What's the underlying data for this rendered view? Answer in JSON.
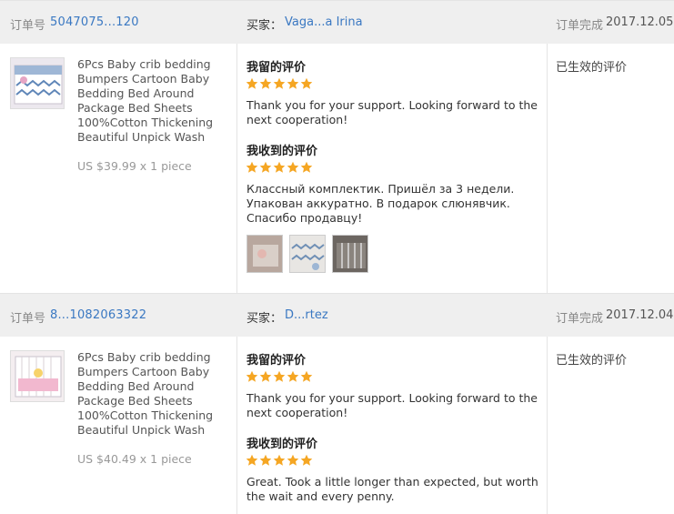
{
  "colors": {
    "header_bg": "#efefef",
    "link": "#3a78c2",
    "star": "#f5a623",
    "divider": "#e4e4e4"
  },
  "orders": [
    {
      "order_label": "订单号",
      "order_number": "5047075...120",
      "buyer_label": "买家：",
      "buyer_name": "Vaga...a Irina",
      "status_label": "订单完成",
      "date": "2017.12.05",
      "product": {
        "title": "6Pcs Baby crib bedding Bumpers Cartoon Baby Bedding Bed Around Package Bed Sheets 100%Cotton Thickening Beautiful Unpick Wash",
        "price": "US $39.99 x 1 piece"
      },
      "my_review": {
        "heading": "我留的评价",
        "rating": 5,
        "text": "Thank you for your support. Looking forward to the next cooperation!"
      },
      "received_review": {
        "heading": "我收到的评价",
        "rating": 5,
        "text": "Классный комплектик. Пришёл за 3 недели. Упакован аккуратно. В подарок слюнявчик. Спасибо продавцу!",
        "photos": [
          "photo-1",
          "photo-2",
          "photo-3"
        ]
      },
      "review_status": "已生效的评价"
    },
    {
      "order_label": "订单号",
      "order_number": "8...1082063322",
      "buyer_label": "买家：",
      "buyer_name": "D...rtez",
      "status_label": "订单完成",
      "date": "2017.12.04",
      "product": {
        "title": "6Pcs Baby crib bedding Bumpers Cartoon Baby Bedding Bed Around Package Bed Sheets 100%Cotton Thickening Beautiful Unpick Wash",
        "price": "US $40.49 x 1 piece"
      },
      "my_review": {
        "heading": "我留的评价",
        "rating": 5,
        "text": "Thank you for your support. Looking forward to the next cooperation!"
      },
      "received_review": {
        "heading": "我收到的评价",
        "rating": 5,
        "text": "Great. Took a little longer than expected, but worth the wait and every penny."
      },
      "review_status": "已生效的评价"
    }
  ]
}
